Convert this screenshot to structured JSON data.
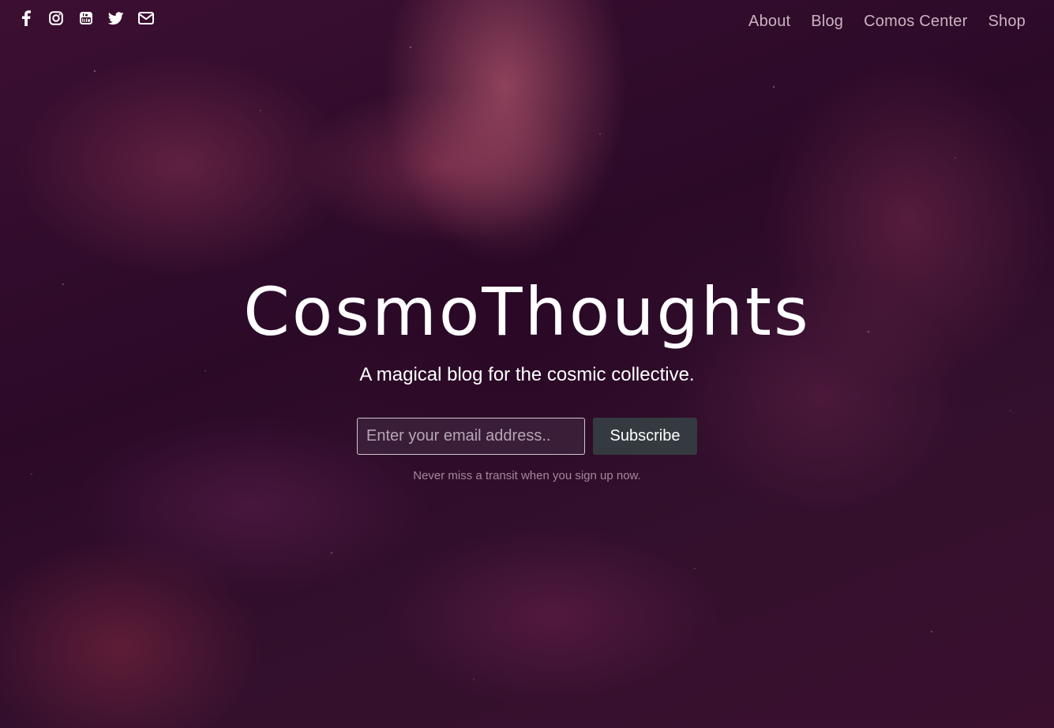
{
  "social": {
    "facebook_icon": "facebook-icon",
    "instagram_icon": "instagram-icon",
    "youtube_icon": "youtube-icon",
    "twitter_icon": "twitter-icon",
    "email_icon": "envelope-icon"
  },
  "nav": {
    "items": [
      {
        "label": "About"
      },
      {
        "label": "Blog"
      },
      {
        "label": "Comos Center"
      },
      {
        "label": "Shop"
      }
    ]
  },
  "hero": {
    "title": "CosmoThoughts",
    "tagline": "A magical blog for the cosmic collective.",
    "email_placeholder": "Enter your email address..",
    "subscribe_label": "Subscribe",
    "note": "Never miss a transit when you sign up now."
  },
  "colors": {
    "background": "#2a0a26",
    "nebula_highlight": "#dc6e82",
    "button": "#343a40",
    "nav_text": "#ebd7e1",
    "note_text": "#c8afc3"
  }
}
